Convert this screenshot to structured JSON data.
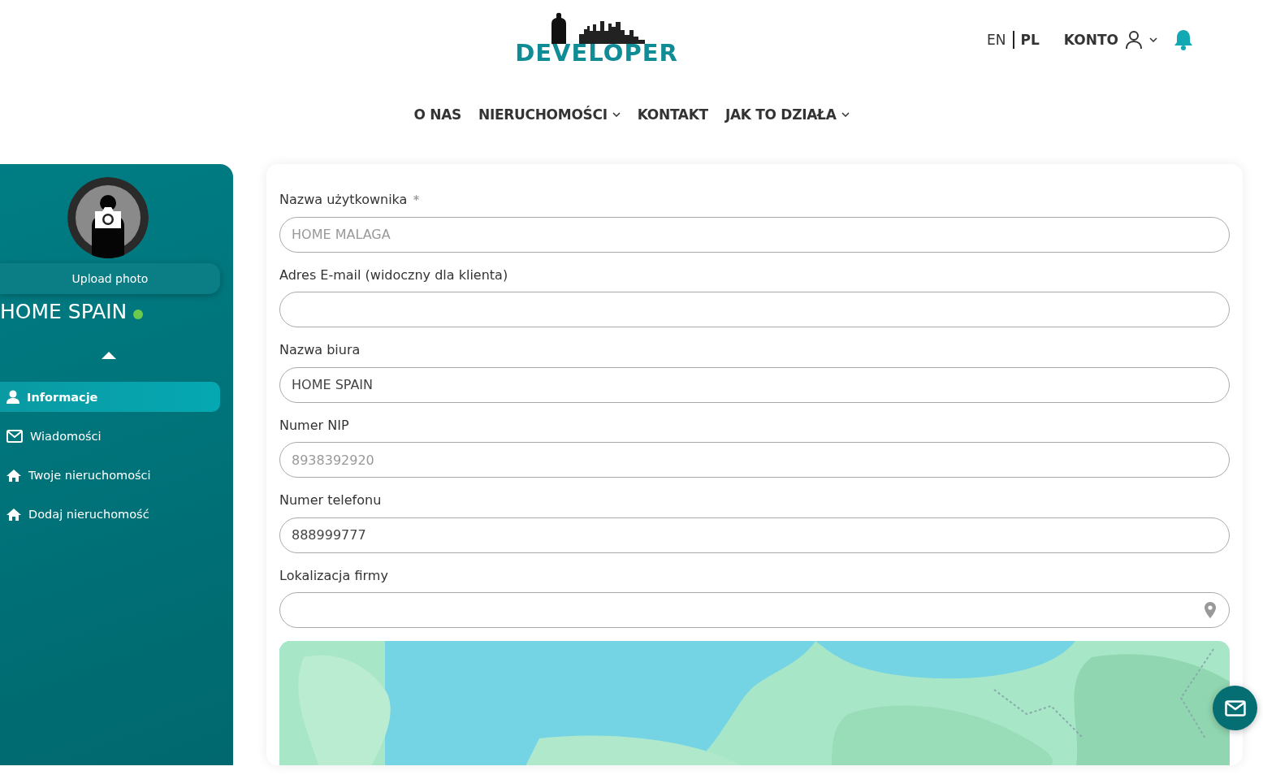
{
  "header": {
    "logo": "DEVELOPER",
    "languages": [
      {
        "label": "EN",
        "selected": false
      },
      {
        "label": "PL",
        "selected": true
      }
    ],
    "account": "KONTO"
  },
  "nav": [
    {
      "label": "O NAS",
      "dropdown": false
    },
    {
      "label": "NIERUCHOMOŚCI",
      "dropdown": true
    },
    {
      "label": "KONTAKT",
      "dropdown": false
    },
    {
      "label": "JAK TO DZIAŁA",
      "dropdown": true
    }
  ],
  "sidebar": {
    "upload": "Upload photo",
    "name": "HOME SPAIN",
    "online": true,
    "items": [
      {
        "label": "Informacje",
        "kind": "user",
        "selected": true
      },
      {
        "label": "Wiadomości",
        "kind": "mail",
        "selected": false
      },
      {
        "label": "Twoje nieruchomości",
        "kind": "home",
        "selected": false
      },
      {
        "label": "Dodaj nieruchomość",
        "kind": "home",
        "selected": false
      }
    ]
  },
  "form": {
    "fields": [
      {
        "label": "Nazwa użytkownika",
        "required": true,
        "placeholder": "HOME MALAGA"
      },
      {
        "label": "Adres E-mail (widoczny dla klienta)",
        "required": false
      },
      {
        "label": "Nazwa biura",
        "required": false,
        "value": "HOME SPAIN"
      },
      {
        "label": "Numer NIP",
        "required": false,
        "placeholder": "8938392920"
      },
      {
        "label": "Numer telefonu",
        "required": false,
        "value": "888999777"
      },
      {
        "label": "Lokalizacja firmy",
        "required": false,
        "kind": "location"
      }
    ]
  }
}
